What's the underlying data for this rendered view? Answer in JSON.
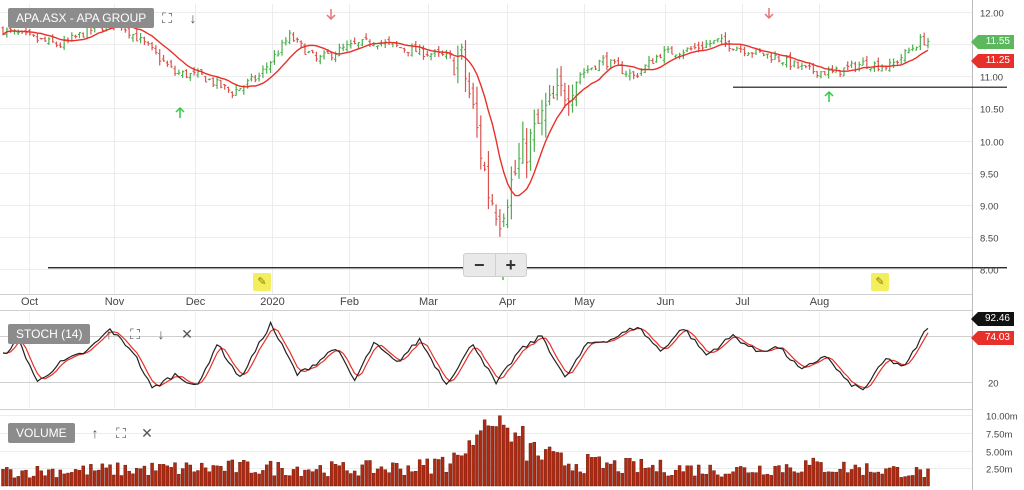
{
  "panels": {
    "price": {
      "title": "APA.ASX - APA GROUP",
      "last_price_tag": "11.55",
      "ma_price_tag": "11.25"
    },
    "stoch": {
      "title": "STOCH (14)",
      "k_tag": "92.46",
      "d_tag": "74.03"
    },
    "volume": {
      "title": "VOLUME"
    }
  },
  "colors": {
    "bar_green": "#4cae4c",
    "bar_red": "#d9534f",
    "moving_average": "#e8302a",
    "stoch_k": "#222222",
    "stoch_d": "#e8302a",
    "volume_fill": "#b02a12",
    "up_arrow": "#2ecc40",
    "down_arrow": "#e57373",
    "price_tag_green": "#5cb85c",
    "price_tag_red": "#e8302a",
    "stoch_tag_black": "#111111"
  },
  "chart_data": [
    {
      "type": "line",
      "subtype": "ohlc",
      "title": "APA.ASX - APA GROUP",
      "x_labels": [
        "Oct",
        "Nov",
        "Dec",
        "2020",
        "Feb",
        "Mar",
        "Apr",
        "May",
        "Jun",
        "Jul",
        "Aug"
      ],
      "y_ticks": [
        "12.00",
        "11.50",
        "11.00",
        "10.50",
        "10.00",
        "9.50",
        "9.00",
        "8.50",
        "8.00"
      ],
      "ylim": [
        8.0,
        12.0
      ],
      "close_anchors": [
        {
          "x": 0,
          "y": 11.72
        },
        {
          "x": 7,
          "y": 11.6
        },
        {
          "x": 15,
          "y": 11.48
        },
        {
          "x": 22,
          "y": 11.7
        },
        {
          "x": 30,
          "y": 11.85
        },
        {
          "x": 38,
          "y": 11.45
        },
        {
          "x": 45,
          "y": 11.05
        },
        {
          "x": 52,
          "y": 11.0
        },
        {
          "x": 60,
          "y": 10.75
        },
        {
          "x": 67,
          "y": 11.0
        },
        {
          "x": 75,
          "y": 11.62
        },
        {
          "x": 82,
          "y": 11.25
        },
        {
          "x": 90,
          "y": 11.45
        },
        {
          "x": 97,
          "y": 11.55
        },
        {
          "x": 105,
          "y": 11.43
        },
        {
          "x": 112,
          "y": 11.35
        },
        {
          "x": 120,
          "y": 11.25
        },
        {
          "x": 123,
          "y": 10.45
        },
        {
          "x": 127,
          "y": 9.2
        },
        {
          "x": 130,
          "y": 8.85
        },
        {
          "x": 135,
          "y": 9.65
        },
        {
          "x": 142,
          "y": 10.45
        },
        {
          "x": 150,
          "y": 11.0
        },
        {
          "x": 157,
          "y": 11.25
        },
        {
          "x": 165,
          "y": 11.0
        },
        {
          "x": 172,
          "y": 11.35
        },
        {
          "x": 180,
          "y": 11.42
        },
        {
          "x": 187,
          "y": 11.55
        },
        {
          "x": 195,
          "y": 11.4
        },
        {
          "x": 202,
          "y": 11.3
        },
        {
          "x": 210,
          "y": 11.1
        },
        {
          "x": 217,
          "y": 11.05
        },
        {
          "x": 225,
          "y": 11.2
        },
        {
          "x": 232,
          "y": 11.15
        },
        {
          "x": 240,
          "y": 11.55
        }
      ],
      "support_levels": [
        10.83,
        8.02
      ],
      "last_price": 11.55,
      "moving_average_last": 11.25
    },
    {
      "type": "line",
      "title": "STOCH (14)",
      "series": [
        {
          "name": "",
          "role": "k"
        },
        {
          "name": "",
          "role": "d"
        }
      ],
      "y_ticks": [
        "20"
      ],
      "ylim": [
        0,
        100
      ],
      "k_anchors": [
        {
          "x": 0,
          "y": 55
        },
        {
          "x": 4,
          "y": 75
        },
        {
          "x": 9,
          "y": 20
        },
        {
          "x": 15,
          "y": 45
        },
        {
          "x": 22,
          "y": 60
        },
        {
          "x": 28,
          "y": 88
        },
        {
          "x": 34,
          "y": 60
        },
        {
          "x": 39,
          "y": 12
        },
        {
          "x": 45,
          "y": 30
        },
        {
          "x": 51,
          "y": 15
        },
        {
          "x": 56,
          "y": 70
        },
        {
          "x": 62,
          "y": 25
        },
        {
          "x": 70,
          "y": 95
        },
        {
          "x": 77,
          "y": 30
        },
        {
          "x": 82,
          "y": 45
        },
        {
          "x": 87,
          "y": 65
        },
        {
          "x": 92,
          "y": 22
        },
        {
          "x": 97,
          "y": 70
        },
        {
          "x": 103,
          "y": 45
        },
        {
          "x": 109,
          "y": 75
        },
        {
          "x": 116,
          "y": 18
        },
        {
          "x": 123,
          "y": 70
        },
        {
          "x": 129,
          "y": 18
        },
        {
          "x": 135,
          "y": 60
        },
        {
          "x": 141,
          "y": 80
        },
        {
          "x": 147,
          "y": 25
        },
        {
          "x": 153,
          "y": 70
        },
        {
          "x": 159,
          "y": 75
        },
        {
          "x": 166,
          "y": 92
        },
        {
          "x": 172,
          "y": 60
        },
        {
          "x": 178,
          "y": 90
        },
        {
          "x": 184,
          "y": 55
        },
        {
          "x": 191,
          "y": 80
        },
        {
          "x": 197,
          "y": 60
        },
        {
          "x": 203,
          "y": 65
        },
        {
          "x": 209,
          "y": 35
        },
        {
          "x": 215,
          "y": 55
        },
        {
          "x": 221,
          "y": 20
        },
        {
          "x": 225,
          "y": 10
        },
        {
          "x": 231,
          "y": 50
        },
        {
          "x": 236,
          "y": 40
        },
        {
          "x": 242,
          "y": 92
        }
      ],
      "k_last": 92.46,
      "d_last": 74.03
    },
    {
      "type": "bar",
      "title": "VOLUME",
      "y_ticks": [
        "10.00m",
        "7.50m",
        "5.00m",
        "2.50m"
      ],
      "ylim": [
        0,
        10.0
      ],
      "unit": "million shares",
      "volume_anchors": [
        {
          "x": 0,
          "y": 2.0
        },
        {
          "x": 30,
          "y": 2.3
        },
        {
          "x": 60,
          "y": 2.6
        },
        {
          "x": 90,
          "y": 2.4
        },
        {
          "x": 110,
          "y": 2.7
        },
        {
          "x": 118,
          "y": 3.8
        },
        {
          "x": 124,
          "y": 7.5
        },
        {
          "x": 128,
          "y": 9.8
        },
        {
          "x": 132,
          "y": 8.0
        },
        {
          "x": 138,
          "y": 5.0
        },
        {
          "x": 145,
          "y": 3.5
        },
        {
          "x": 160,
          "y": 2.8
        },
        {
          "x": 190,
          "y": 2.2
        },
        {
          "x": 210,
          "y": 2.9
        },
        {
          "x": 230,
          "y": 2.3
        },
        {
          "x": 242,
          "y": 1.8
        }
      ]
    }
  ]
}
